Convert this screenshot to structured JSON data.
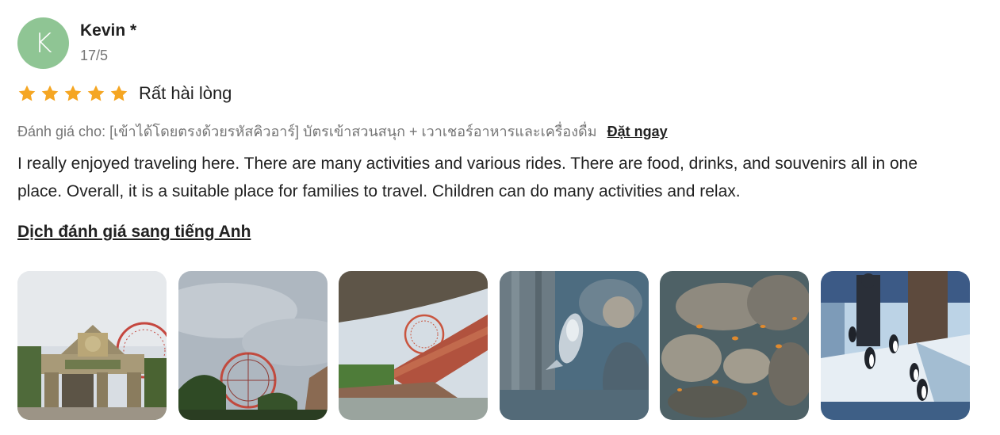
{
  "review": {
    "avatar_initial": "K",
    "avatar_color": "#8fc594",
    "user_name": "Kevin *",
    "date": "17/5",
    "rating_stars": 5,
    "star_color": "#f5a623",
    "rating_label": "Rất hài lòng",
    "reviewed_for_prefix": "Đánh giá cho:",
    "reviewed_for_item": "[เข้าได้โดยตรงด้วยรหัสคิวอาร์] บัตรเข้าสวนสนุก + เวาเชอร์อาหารและเครื่องดื่ม",
    "book_now_label": "Đặt ngay",
    "text": "I really enjoyed traveling here. There are many activities and various rides. There are food, drinks, and souvenirs all in one place. Overall, it is a suitable place for families to travel. Children can do many activities and relax.",
    "translate_label": "Dịch đánh giá sang tiếng Anh"
  },
  "photos": [
    {
      "subject": "park-entrance-gate"
    },
    {
      "subject": "ferris-wheel-sky"
    },
    {
      "subject": "bridge-and-ferris-wheel"
    },
    {
      "subject": "aquarium-fish"
    },
    {
      "subject": "aquarium-rocks-fish"
    },
    {
      "subject": "penguin-exhibit"
    }
  ]
}
